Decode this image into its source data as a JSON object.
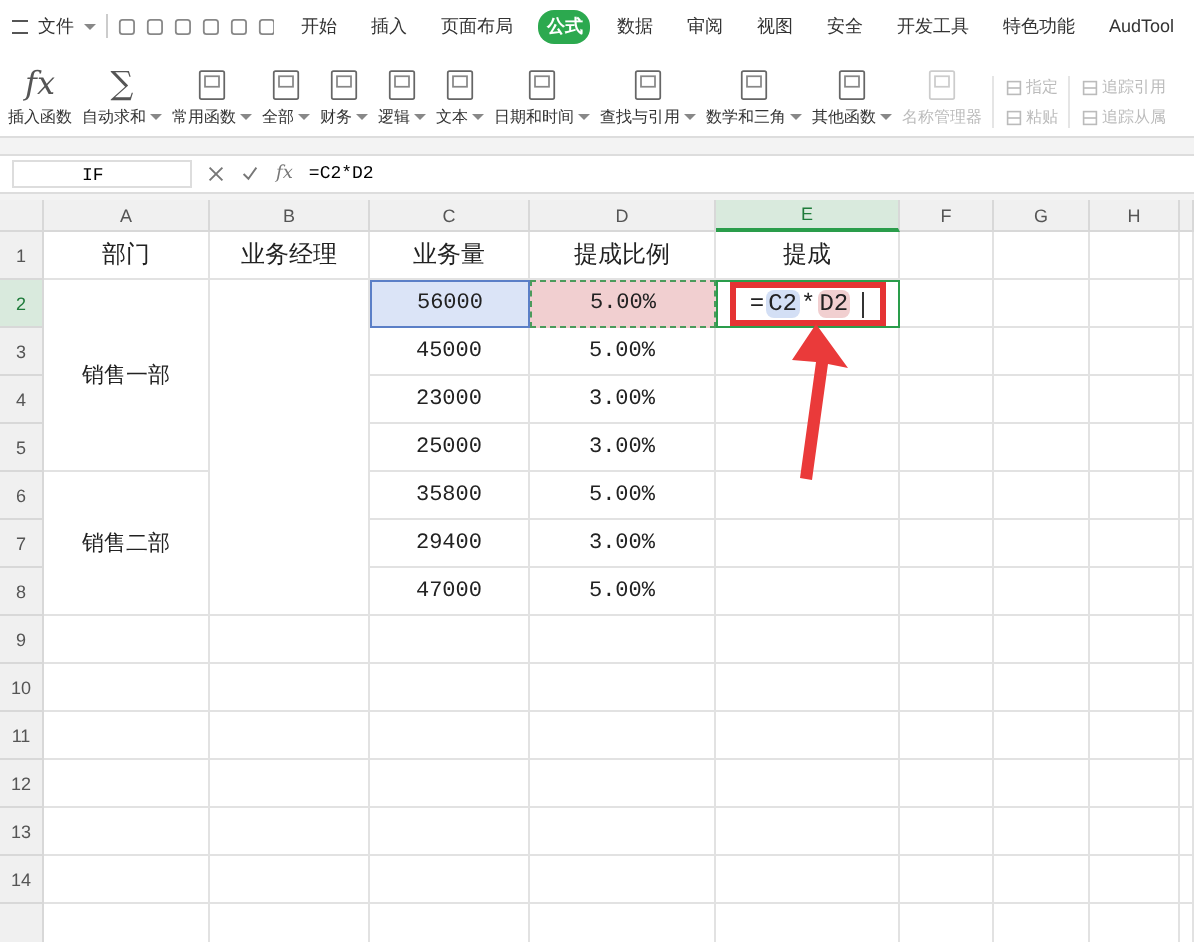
{
  "menu": {
    "file": "文件",
    "tabs": [
      {
        "label": "开始",
        "selected": false
      },
      {
        "label": "插入",
        "selected": false
      },
      {
        "label": "页面布局",
        "selected": false
      },
      {
        "label": "公式",
        "selected": true
      },
      {
        "label": "数据",
        "selected": false
      },
      {
        "label": "审阅",
        "selected": false
      },
      {
        "label": "视图",
        "selected": false
      },
      {
        "label": "安全",
        "selected": false
      },
      {
        "label": "开发工具",
        "selected": false
      },
      {
        "label": "特色功能",
        "selected": false
      },
      {
        "label": "AudTool",
        "selected": false
      }
    ]
  },
  "ribbon": [
    {
      "kind": "glyph",
      "glyph": "fx",
      "label": "插入函数",
      "dropdown": false
    },
    {
      "kind": "glyph",
      "glyph": "∑",
      "label": "自动求和",
      "dropdown": true
    },
    {
      "kind": "book",
      "label": "常用函数",
      "dropdown": true
    },
    {
      "kind": "book",
      "label": "全部",
      "dropdown": true
    },
    {
      "kind": "book",
      "label": "财务",
      "dropdown": true
    },
    {
      "kind": "book",
      "label": "逻辑",
      "dropdown": true
    },
    {
      "kind": "book",
      "label": "文本",
      "dropdown": true
    },
    {
      "kind": "book",
      "label": "日期和时间",
      "dropdown": true
    },
    {
      "kind": "book",
      "label": "查找与引用",
      "dropdown": true
    },
    {
      "kind": "book",
      "label": "数学和三角",
      "dropdown": true
    },
    {
      "kind": "book",
      "label": "其他函数",
      "dropdown": true
    },
    {
      "kind": "book",
      "label": "名称管理器",
      "dropdown": false,
      "disabled": true
    }
  ],
  "ribbon_small": [
    [
      {
        "label": "指定",
        "disabled": true
      },
      {
        "label": "粘贴",
        "disabled": true
      }
    ],
    [
      {
        "label": "追踪引用",
        "disabled": true
      },
      {
        "label": "追踪从属",
        "disabled": true
      }
    ]
  ],
  "formula_bar": {
    "name_box": "IF",
    "fx": "fx",
    "formula": "=C2*D2"
  },
  "sheet": {
    "columns": [
      {
        "label": "A",
        "selected": false
      },
      {
        "label": "B",
        "selected": false
      },
      {
        "label": "C",
        "selected": false
      },
      {
        "label": "D",
        "selected": false
      },
      {
        "label": "E",
        "selected": true
      },
      {
        "label": "F",
        "selected": false
      },
      {
        "label": "G",
        "selected": false
      },
      {
        "label": "H",
        "selected": false
      }
    ],
    "row_numbers": [
      {
        "label": "1",
        "selected": false
      },
      {
        "label": "2",
        "selected": true
      },
      {
        "label": "3",
        "selected": false
      },
      {
        "label": "4",
        "selected": false
      },
      {
        "label": "5",
        "selected": false
      },
      {
        "label": "6",
        "selected": false
      },
      {
        "label": "7",
        "selected": false
      },
      {
        "label": "8",
        "selected": false
      },
      {
        "label": "9",
        "selected": false
      },
      {
        "label": "10",
        "selected": false
      },
      {
        "label": "11",
        "selected": false
      },
      {
        "label": "12",
        "selected": false
      },
      {
        "label": "13",
        "selected": false
      },
      {
        "label": "14",
        "selected": false
      }
    ],
    "headers": [
      "部门",
      "业务经理",
      "业务量",
      "提成比例",
      "提成"
    ],
    "departments": [
      {
        "name": "销售一部",
        "rows": [
          {
            "volume": "56000",
            "rate": "5.00%",
            "referenced": true
          },
          {
            "volume": "45000",
            "rate": "5.00%",
            "referenced": false
          },
          {
            "volume": "23000",
            "rate": "3.00%",
            "referenced": false
          },
          {
            "volume": "25000",
            "rate": "3.00%",
            "referenced": false
          }
        ]
      },
      {
        "name": "销售二部",
        "rows": [
          {
            "volume": "35800",
            "rate": "5.00%",
            "referenced": false
          },
          {
            "volume": "29400",
            "rate": "3.00%",
            "referenced": false
          },
          {
            "volume": "47000",
            "rate": "5.00%",
            "referenced": false
          }
        ]
      }
    ],
    "editing": [
      {
        "text": "=",
        "color": "#ffffff"
      },
      {
        "text": "C2",
        "color": "#d3dff5"
      },
      {
        "text": "*",
        "color": "#ffffff"
      },
      {
        "text": "D2",
        "color": "#f1cfd0"
      }
    ]
  }
}
